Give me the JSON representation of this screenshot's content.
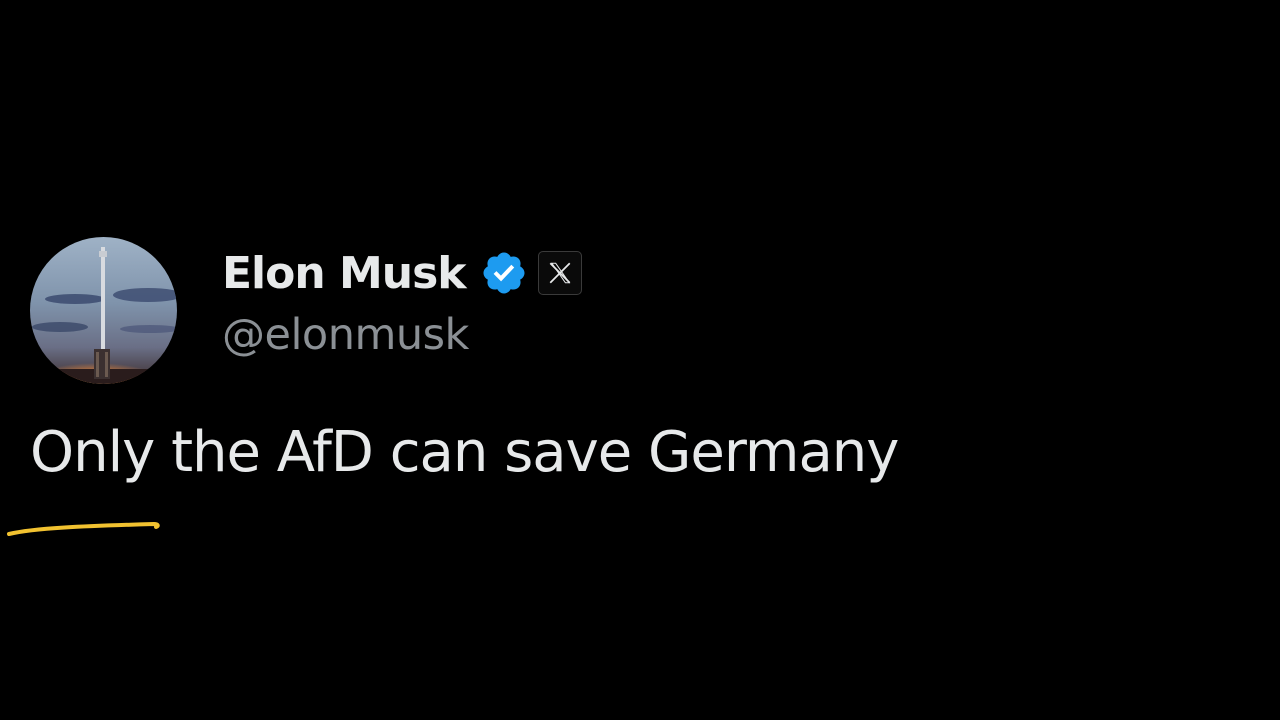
{
  "tweet": {
    "author": {
      "display_name": "Elon Musk",
      "handle": "@elonmusk",
      "avatar_icon": "rocket-launch-avatar",
      "verified_icon": "verified-badge-icon",
      "verified_color": "#1d9bf0",
      "affiliation_icon": "x-logo-icon"
    },
    "text": "Only the AfD can save Germany"
  },
  "annotation": {
    "type": "hand-drawn-underline",
    "color": "#f2c230"
  },
  "colors": {
    "background": "#000000",
    "primary_text": "#e7e9ea",
    "secondary_text": "#8b9095"
  }
}
